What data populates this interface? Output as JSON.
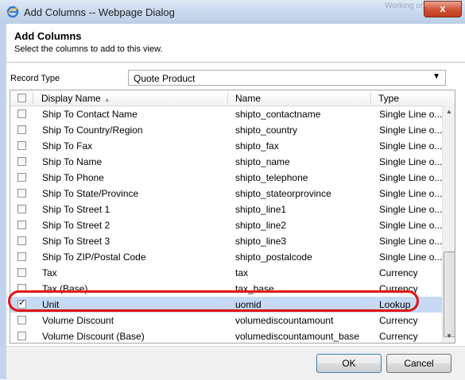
{
  "window": {
    "title": "Add Columns -- Webpage Dialog",
    "ghost_text": "Working on ...",
    "close_label": "x"
  },
  "dialog": {
    "heading": "Add Columns",
    "subheading": "Select the columns to add to this view."
  },
  "record_type": {
    "label": "Record Type",
    "value": "Quote Product"
  },
  "grid": {
    "columns": [
      "Display Name",
      "Name",
      "Type"
    ],
    "rows": [
      {
        "display": "Ship To Contact Name",
        "name": "shipto_contactname",
        "type": "Single Line o...",
        "checked": false
      },
      {
        "display": "Ship To Country/Region",
        "name": "shipto_country",
        "type": "Single Line o...",
        "checked": false
      },
      {
        "display": "Ship To Fax",
        "name": "shipto_fax",
        "type": "Single Line o...",
        "checked": false
      },
      {
        "display": "Ship To Name",
        "name": "shipto_name",
        "type": "Single Line o...",
        "checked": false
      },
      {
        "display": "Ship To Phone",
        "name": "shipto_telephone",
        "type": "Single Line o...",
        "checked": false
      },
      {
        "display": "Ship To State/Province",
        "name": "shipto_stateorprovince",
        "type": "Single Line o...",
        "checked": false
      },
      {
        "display": "Ship To Street 1",
        "name": "shipto_line1",
        "type": "Single Line o...",
        "checked": false
      },
      {
        "display": "Ship To Street 2",
        "name": "shipto_line2",
        "type": "Single Line o...",
        "checked": false
      },
      {
        "display": "Ship To Street 3",
        "name": "shipto_line3",
        "type": "Single Line o...",
        "checked": false
      },
      {
        "display": "Ship To ZIP/Postal Code",
        "name": "shipto_postalcode",
        "type": "Single Line o...",
        "checked": false
      },
      {
        "display": "Tax",
        "name": "tax",
        "type": "Currency",
        "checked": false
      },
      {
        "display": "Tax (Base)",
        "name": "tax_base",
        "type": "Currency",
        "checked": false
      },
      {
        "display": "Unit",
        "name": "uomid",
        "type": "Lookup",
        "checked": true
      },
      {
        "display": "Volume Discount",
        "name": "volumediscountamount",
        "type": "Currency",
        "checked": false
      },
      {
        "display": "Volume Discount (Base)",
        "name": "volumediscountamount_base",
        "type": "Currency",
        "checked": false
      }
    ]
  },
  "buttons": {
    "ok": "OK",
    "cancel": "Cancel"
  },
  "colors": {
    "selected_row": "#c6daf5",
    "highlight": "#e21212"
  }
}
